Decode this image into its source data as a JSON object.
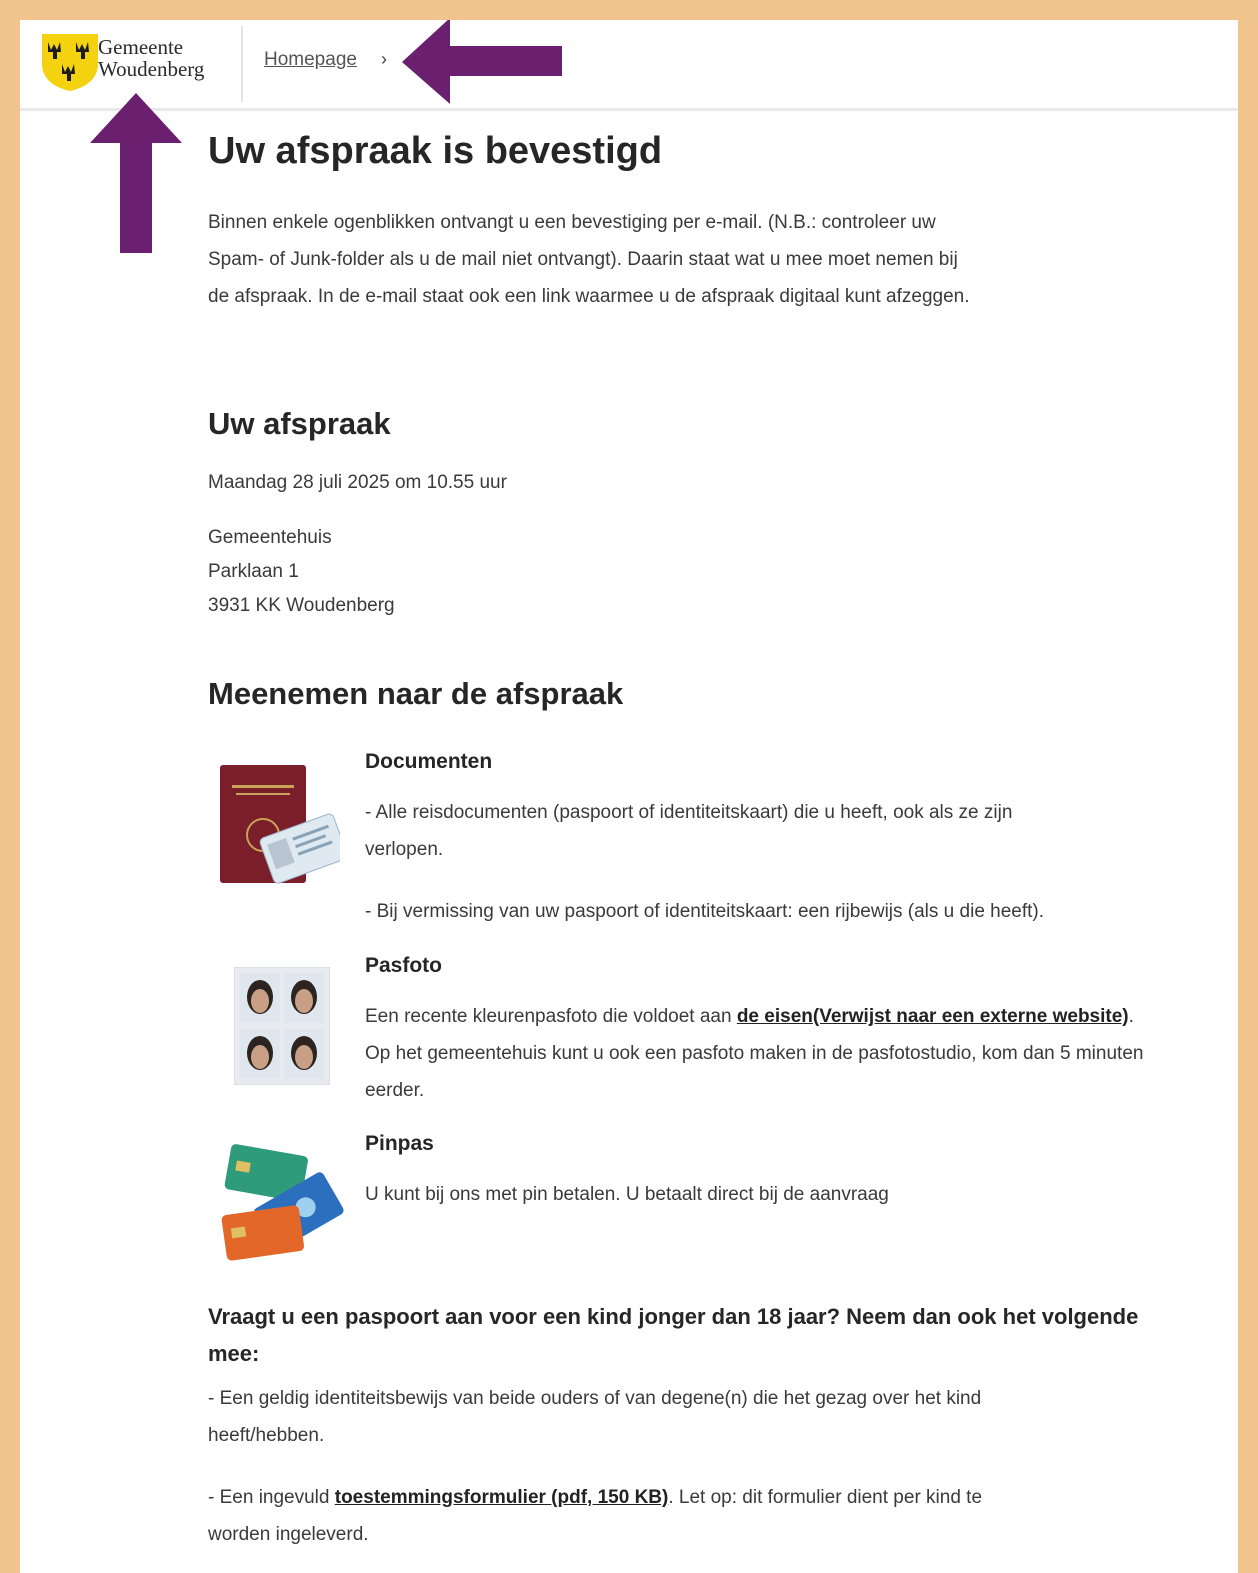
{
  "header": {
    "logo_line1": "Gemeente",
    "logo_line2": "Woudenberg",
    "breadcrumb": "Homepage",
    "breadcrumb_sep": "›"
  },
  "main": {
    "title": "Uw afspraak is bevestigd",
    "intro": "Binnen enkele ogenblikken ontvangt u een bevestiging per e-mail. (N.B.: controleer uw Spam- of Junk-folder als u de mail niet ontvangt). Daarin staat wat u mee moet nemen bij de afspraak. In de e-mail staat ook een link waarmee u de afspraak digitaal kunt afzeggen.",
    "appointment_heading": "Uw afspraak",
    "appointment_datetime": "Maandag 28 juli 2025 om 10.55 uur",
    "location_name": "Gemeentehuis",
    "location_street": "Parklaan 1",
    "location_city": "3931 KK Woudenberg",
    "bring_heading": "Meenemen naar de afspraak",
    "items": [
      {
        "title": "Documenten",
        "text1": "- Alle reisdocumenten (paspoort of identiteitskaart) die u heeft, ook als ze zijn verlopen.",
        "text2": "- Bij vermissing van uw paspoort of identiteitskaart: een rijbewijs (als u die heeft)."
      },
      {
        "title": "Pasfoto",
        "text_before": "Een recente kleurenpasfoto die voldoet aan ",
        "link": "de eisen(Verwijst naar een externe website)",
        "text_after": ". Op het gemeentehuis kunt u ook een pasfoto maken in de pasfotostudio, kom dan 5 minuten eerder."
      },
      {
        "title": "Pinpas",
        "text": "U kunt bij ons met pin betalen. U betaalt direct bij de aanvraag"
      }
    ],
    "child_question": "Vraagt u een paspoort aan voor een kind jonger dan 18 jaar? Neem dan ook het volgende mee:",
    "child_item1": "- Een geldig identiteitsbewijs van beide ouders of van degene(n) die het gezag over het kind heeft/hebben.",
    "child_item2_before": "- Een ingevuld ",
    "child_item2_link": "toestemmingsformulier (pdf, 150 KB)",
    "child_item2_after": ". Let op: dit formulier dient per kind te worden ingeleverd."
  },
  "icons": {
    "logo": "woudenberg-shield-logo",
    "annotation_arrows": "purple-arrow"
  },
  "colors": {
    "border": "#f2c48d",
    "arrow": "#6b1f6f",
    "logo_yellow": "#f5d20f"
  }
}
